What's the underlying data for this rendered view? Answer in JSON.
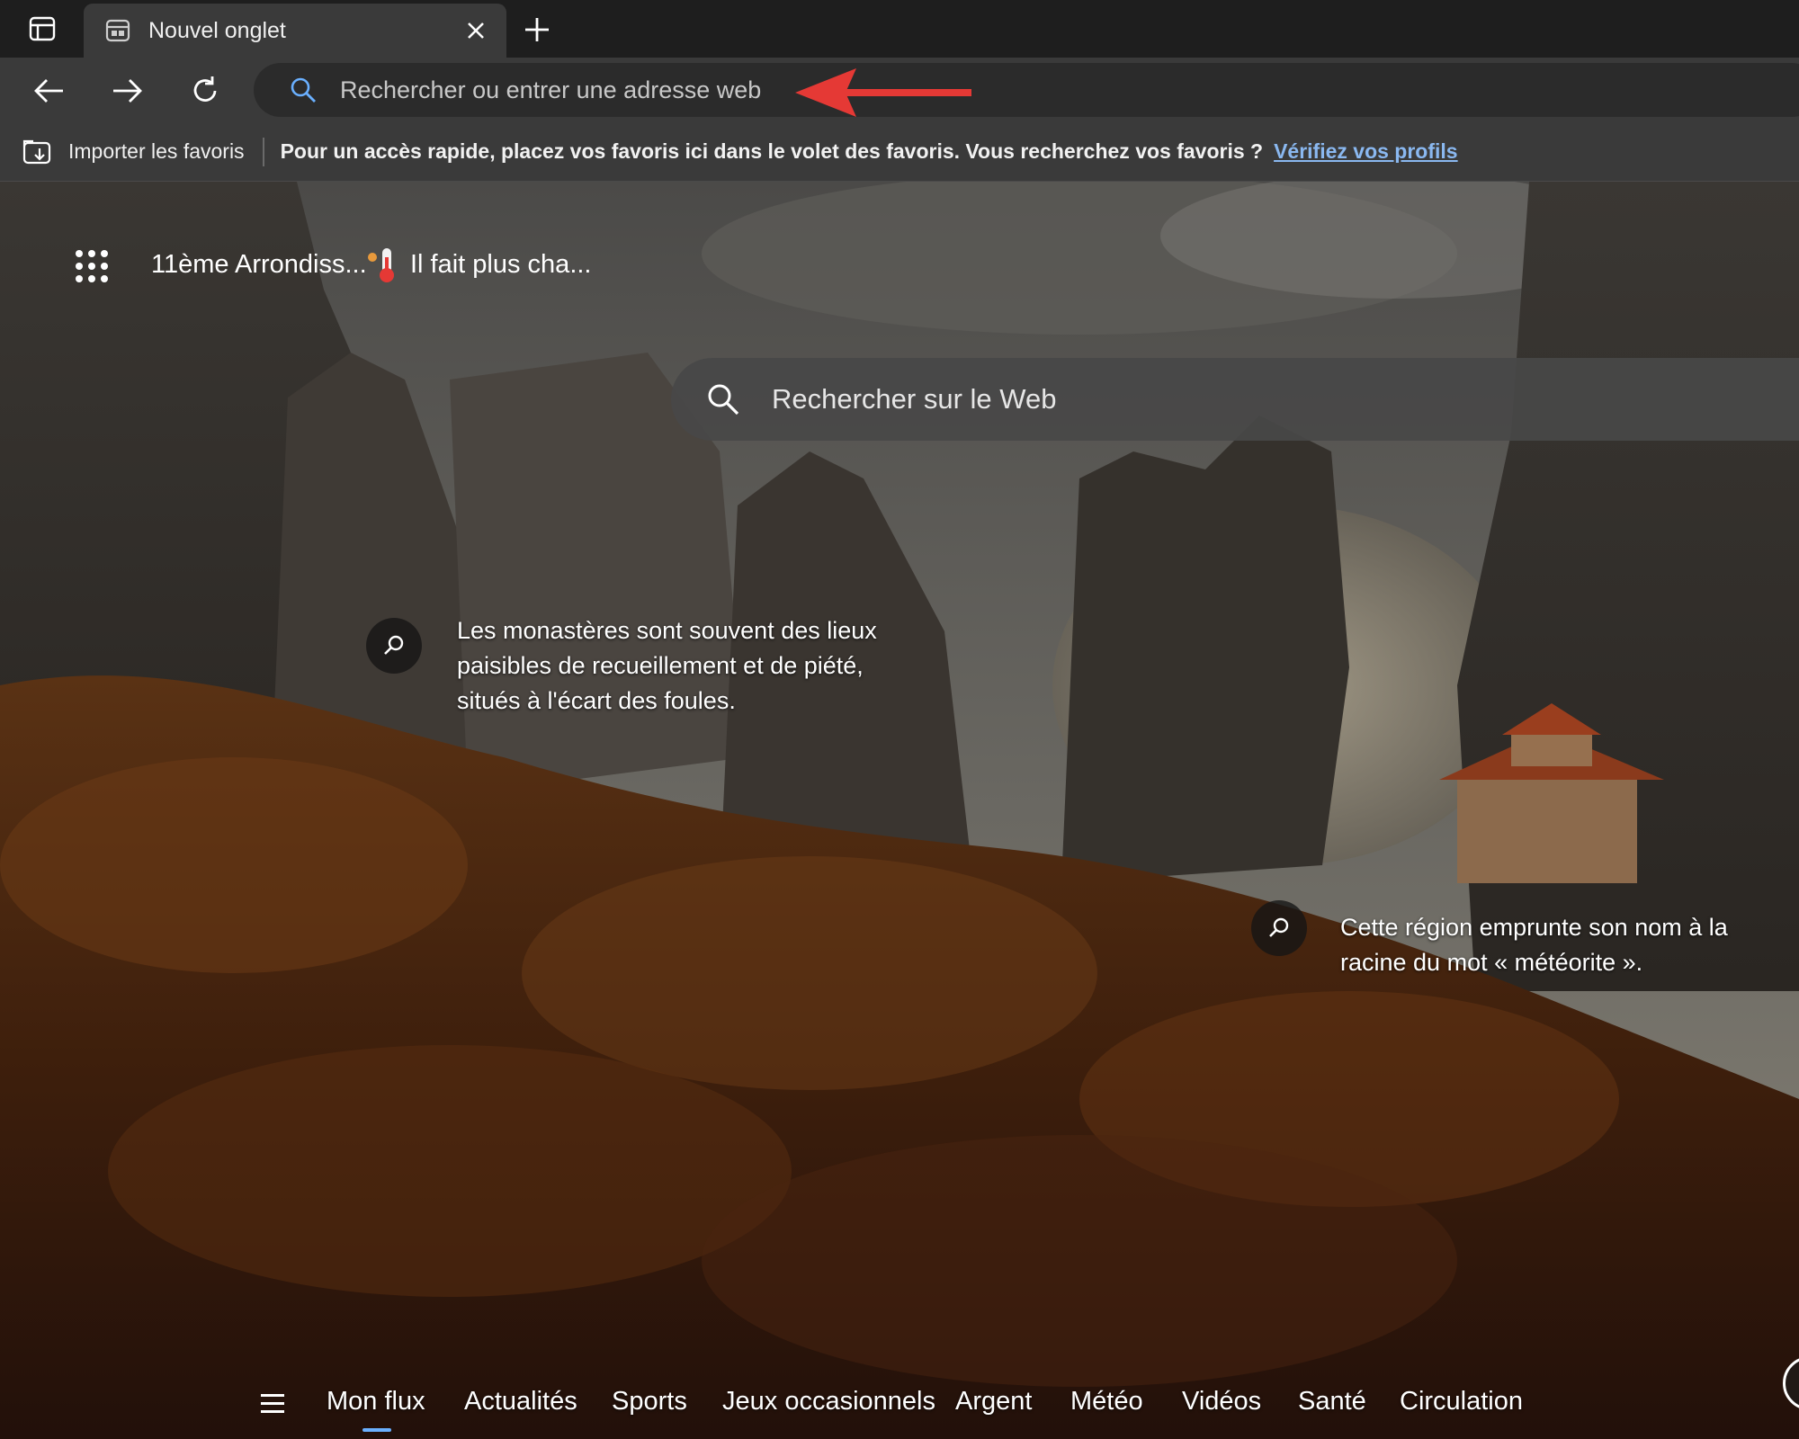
{
  "tab": {
    "title": "Nouvel onglet"
  },
  "toolbar": {
    "address_placeholder": "Rechercher ou entrer une adresse web"
  },
  "favorites_bar": {
    "import_label": "Importer les favoris",
    "message": "Pour un accès rapide, placez vos favoris ici dans le volet des favoris. Vous recherchez vos favoris ?",
    "link_label": "Vérifiez vos profils"
  },
  "widgets": {
    "location": "11ème Arrondiss...",
    "weather_text": "Il fait plus cha..."
  },
  "search": {
    "placeholder": "Rechercher sur le Web"
  },
  "hotspots": [
    {
      "text_lines": [
        "Les monastères sont souvent des lieux",
        "paisibles de recueillement et de piété,",
        "situés à l'écart des foules."
      ]
    },
    {
      "text_lines": [
        "Cette région emprunte son nom à la",
        "racine du mot « météorite »."
      ]
    }
  ],
  "bottom_nav": {
    "items": [
      "Mon flux",
      "Actualités",
      "Sports",
      "Jeux occasionnels",
      "Argent",
      "Météo",
      "Vidéos",
      "Santé",
      "Circulation"
    ],
    "active_index": 0
  },
  "colors": {
    "annotation_arrow": "#e53935",
    "link": "#8ab8f0",
    "active_underline": "#6ab0ff"
  }
}
